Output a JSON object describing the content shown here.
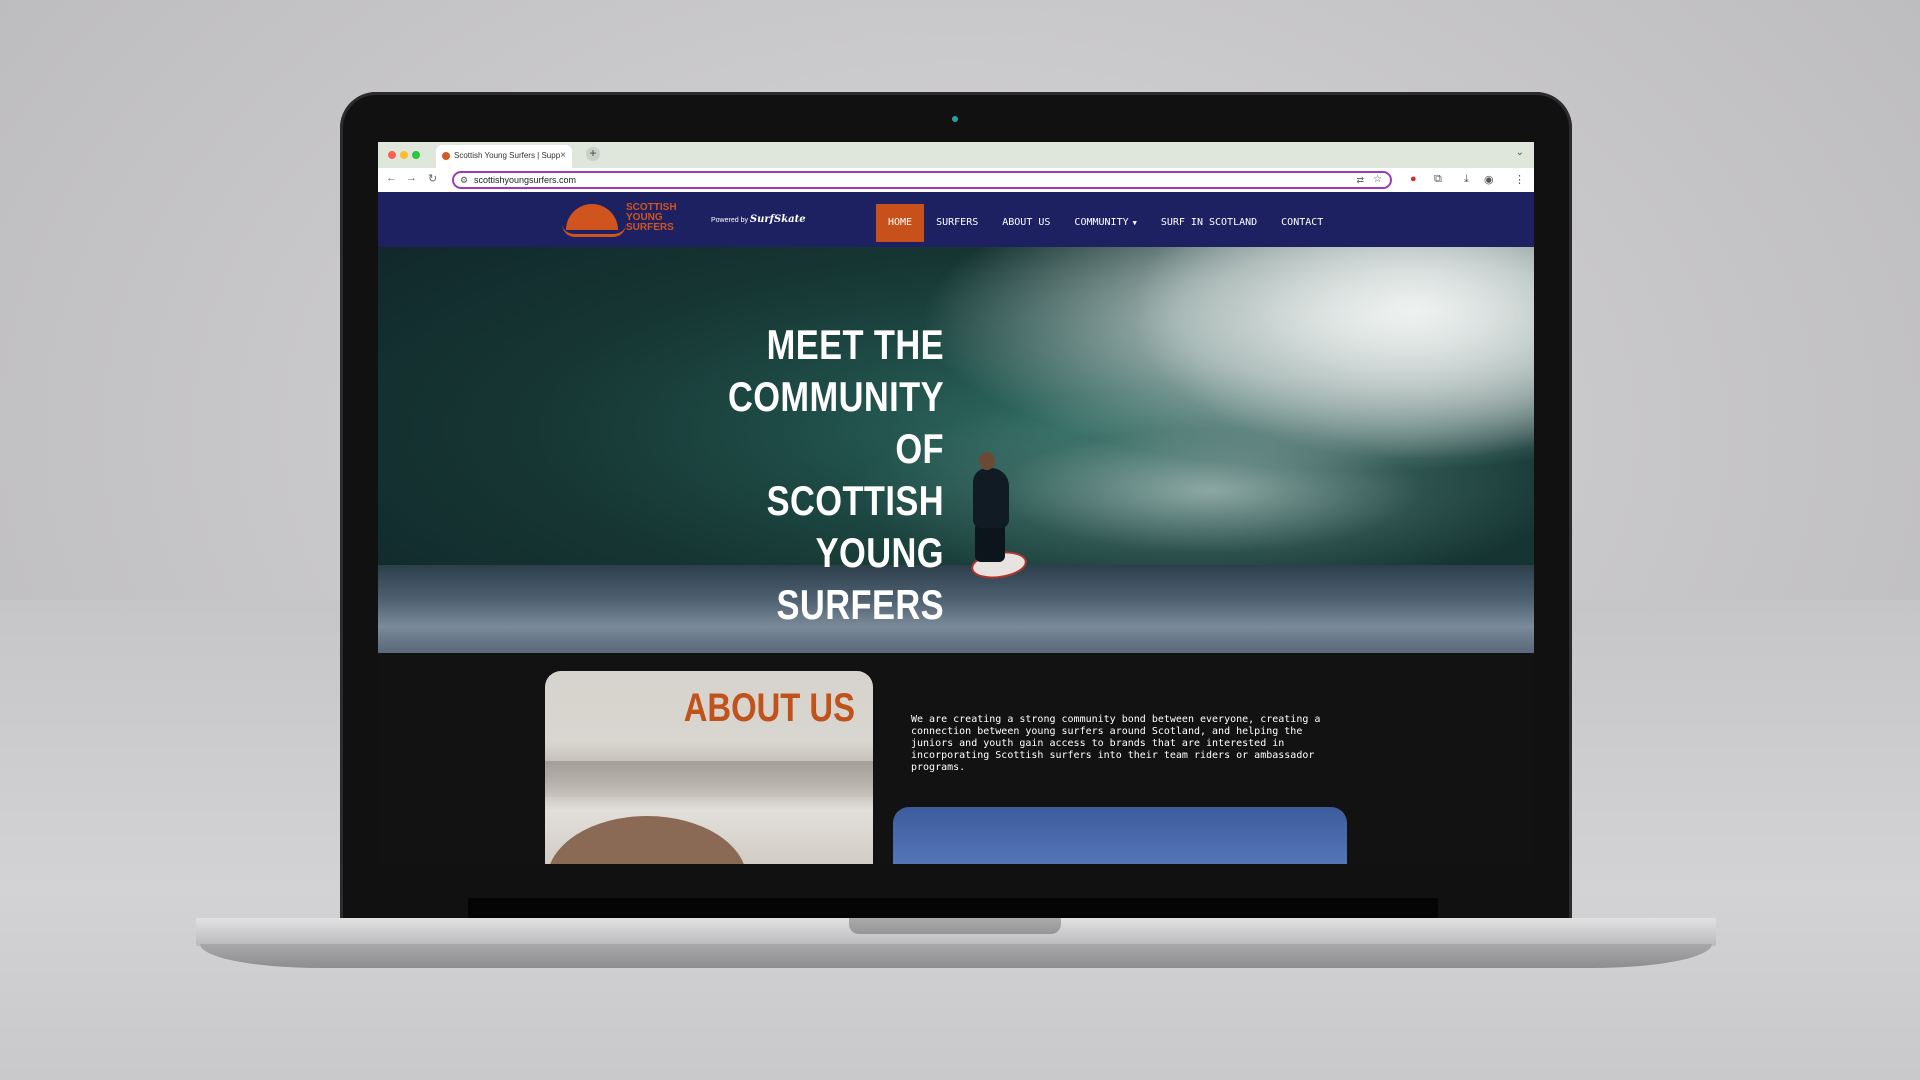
{
  "browser": {
    "tab_title": "Scottish Young Surfers | Supp",
    "url": "scottishyoungsurfers.com",
    "new_tab_label": "+",
    "close_tab_label": "×"
  },
  "site": {
    "logo_text": [
      "SCOTTISH",
      "YOUNG",
      "SURFERS"
    ],
    "powered_by": "Powered by",
    "powered_brand": "SurfSkate",
    "nav": [
      {
        "label": "HOME",
        "active": true
      },
      {
        "label": "SURFERS"
      },
      {
        "label": "ABOUT US"
      },
      {
        "label": "COMMUNITY",
        "has_dropdown": true
      },
      {
        "label": "SURF IN SCOTLAND"
      },
      {
        "label": "CONTACT"
      }
    ],
    "hero_title": "MEET THE COMMUNITY OF SCOTTISH YOUNG SURFERS",
    "about_heading": "ABOUT US",
    "about_text": "We are creating a strong community bond between everyone, creating a connection between young surfers around Scotland, and helping the juniors and youth gain access to brands that are interested in incorporating Scottish surfers into their team riders or ambassador programs."
  },
  "colors": {
    "nav_bg": "#1d2162",
    "accent": "#c8501b",
    "page_bg": "#121212"
  }
}
